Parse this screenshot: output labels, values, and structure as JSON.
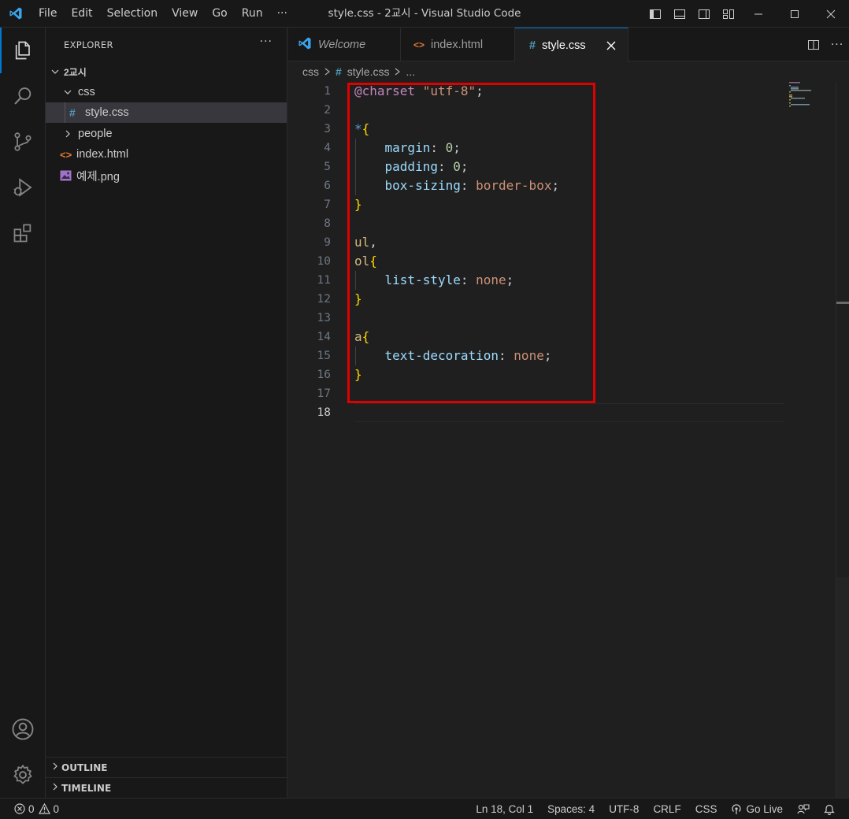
{
  "window": {
    "title": "style.css - 2교시 - Visual Studio Code",
    "menu": [
      "File",
      "Edit",
      "Selection",
      "View",
      "Go",
      "Run",
      "···"
    ]
  },
  "sidebar": {
    "header": "EXPLORER",
    "more": "···",
    "tree": {
      "root": "2교시",
      "folder_css": "css",
      "file_style": "style.css",
      "folder_people": "people",
      "file_index": "index.html",
      "file_png": "예제.png"
    },
    "outline": "OUTLINE",
    "timeline": "TIMELINE"
  },
  "tabs": [
    {
      "label": "Welcome",
      "icon": "vscode-icon"
    },
    {
      "label": "index.html",
      "icon": "html-icon"
    },
    {
      "label": "style.css",
      "icon": "css-hash-icon",
      "active": true
    }
  ],
  "breadcrumb": {
    "folder": "css",
    "file": "style.css",
    "rest": "..."
  },
  "editor": {
    "line_numbers": [
      "1",
      "2",
      "3",
      "4",
      "5",
      "6",
      "7",
      "8",
      "9",
      "10",
      "11",
      "12",
      "13",
      "14",
      "15",
      "16",
      "17",
      "18"
    ],
    "current_line": "18",
    "code": {
      "charset_kw": "@charset",
      "charset_val": "\"utf-8\"",
      "semi": ";",
      "star": "*",
      "open": "{",
      "close": "}",
      "colon": ": ",
      "margin": "margin",
      "padding": "padding",
      "boxsizing": "box-sizing",
      "zero": "0",
      "borderbox": "border-box",
      "ul": "ul",
      "comma": ",",
      "ol": "ol",
      "liststyle": "list-style",
      "none": "none",
      "a": "a",
      "textdeco": "text-decoration"
    }
  },
  "status": {
    "errors": "0",
    "warnings": "0",
    "position": "Ln 18, Col 1",
    "spaces": "Spaces: 4",
    "encoding": "UTF-8",
    "eol": "CRLF",
    "language": "CSS",
    "golive": "Go Live"
  },
  "colors": {
    "accent": "#0078d4",
    "highlight_box": "#e00000"
  }
}
